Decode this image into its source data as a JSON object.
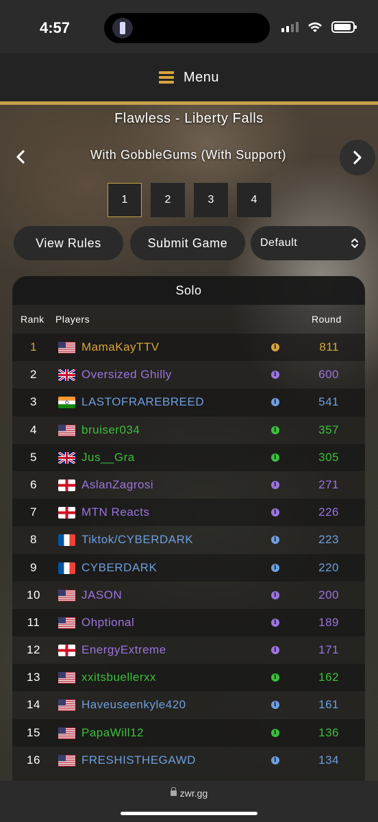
{
  "status_bar": {
    "time": "4:57"
  },
  "menu": {
    "label": "Menu"
  },
  "map_title": "Flawless - Liberty Falls",
  "category": "With GobbleGums (With Support)",
  "pagination": {
    "pages": [
      "1",
      "2",
      "3",
      "4"
    ],
    "active": "1"
  },
  "actions": {
    "view_rules": "View Rules",
    "submit_game": "Submit Game",
    "sort_selected": "Default"
  },
  "leaderboard": {
    "group": "Solo",
    "columns": {
      "rank": "Rank",
      "players": "Players",
      "round": "Round"
    },
    "rows": [
      {
        "rank": "1",
        "flag": "us",
        "name": "MamaKayTTV",
        "round": "811",
        "color": "#d9a53b"
      },
      {
        "rank": "2",
        "flag": "gb",
        "name": "Oversized Ghilly",
        "round": "600",
        "color": "#9b74e0"
      },
      {
        "rank": "3",
        "flag": "in",
        "name": "LASTOFRAREBREED",
        "round": "541",
        "color": "#6f9fe0"
      },
      {
        "rank": "4",
        "flag": "us",
        "name": "bruiser034",
        "round": "357",
        "color": "#3cbf3c"
      },
      {
        "rank": "5",
        "flag": "gb",
        "name": "Jus__Gra",
        "round": "305",
        "color": "#3cbf3c"
      },
      {
        "rank": "6",
        "flag": "en",
        "name": "AslanZagrosi",
        "round": "271",
        "color": "#9b74e0"
      },
      {
        "rank": "7",
        "flag": "en",
        "name": "MTN Reacts",
        "round": "226",
        "color": "#9b74e0"
      },
      {
        "rank": "8",
        "flag": "fr",
        "name": "Tiktok/CYBERDARK",
        "round": "223",
        "color": "#6f9fe0"
      },
      {
        "rank": "9",
        "flag": "fr",
        "name": "CYBERDARK",
        "round": "220",
        "color": "#6f9fe0"
      },
      {
        "rank": "10",
        "flag": "us",
        "name": "JASON",
        "round": "200",
        "color": "#9b74e0"
      },
      {
        "rank": "11",
        "flag": "us",
        "name": "Ohptional",
        "round": "189",
        "color": "#9b74e0"
      },
      {
        "rank": "12",
        "flag": "en",
        "name": "EnergyExtreme",
        "round": "171",
        "color": "#9b74e0"
      },
      {
        "rank": "13",
        "flag": "us",
        "name": "xxitsbuellerxx",
        "round": "162",
        "color": "#3cbf3c"
      },
      {
        "rank": "14",
        "flag": "us",
        "name": "Haveuseenkyle420",
        "round": "161",
        "color": "#6f9fe0"
      },
      {
        "rank": "15",
        "flag": "us",
        "name": "PapaWill12",
        "round": "136",
        "color": "#3cbf3c"
      },
      {
        "rank": "16",
        "flag": "us",
        "name": "FRESHISTHEGAWD",
        "round": "134",
        "color": "#6f9fe0"
      }
    ]
  },
  "browser": {
    "url": "zwr.gg"
  },
  "colors": {
    "accent": "#c9a24a",
    "rank1": "#d9a53b",
    "purple": "#9b74e0",
    "blue": "#6f9fe0",
    "green": "#3cbf3c"
  },
  "icons": [
    "flashlight-icon",
    "cellular-signal-icon",
    "wifi-icon",
    "battery-icon",
    "hamburger-icon",
    "chevron-left-icon",
    "chevron-right-icon",
    "updown-chevron-icon",
    "info-icon",
    "lock-icon"
  ]
}
